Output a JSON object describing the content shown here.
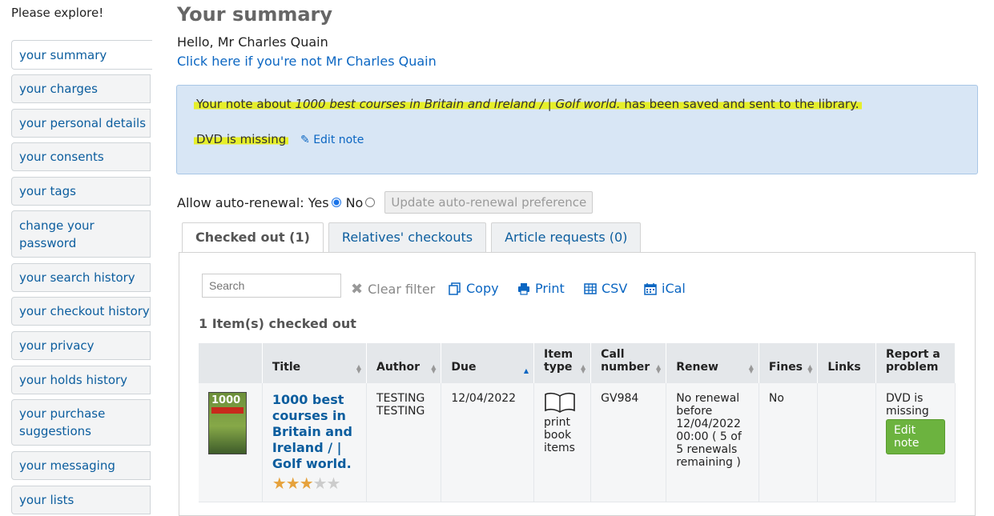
{
  "sidebar": {
    "heading": "Please explore!",
    "items": [
      {
        "label": "your summary"
      },
      {
        "label": "your charges"
      },
      {
        "label": "your personal details"
      },
      {
        "label": "your consents"
      },
      {
        "label": "your tags"
      },
      {
        "label": "change your password"
      },
      {
        "label": "your search history"
      },
      {
        "label": "your checkout history"
      },
      {
        "label": "your privacy"
      },
      {
        "label": "your holds history"
      },
      {
        "label": "your purchase suggestions"
      },
      {
        "label": "your messaging"
      },
      {
        "label": "your lists"
      }
    ]
  },
  "main": {
    "title": "Your summary",
    "hello": "Hello, Mr Charles Quain",
    "not_me_link": "Click here if you're not Mr Charles Quain",
    "alert": {
      "prefix": "Your note about ",
      "book_title": "1000 best courses in Britain and Ireland / | Golf world.",
      "suffix": " has been saved and sent to the library.",
      "note": "DVD is missing",
      "edit_note_link": "Edit note"
    },
    "autorenew": {
      "label": "Allow auto-renewal:",
      "yes": "Yes",
      "no": "No",
      "selected": "Yes",
      "update_button": "Update auto-renewal preference"
    },
    "tabs": [
      {
        "label": "Checked out (1)",
        "active": true
      },
      {
        "label": "Relatives' checkouts",
        "active": false
      },
      {
        "label": "Article requests (0)",
        "active": false
      }
    ],
    "toolbar": {
      "search_placeholder": "Search",
      "clear_filter": "Clear filter",
      "copy": "Copy",
      "print": "Print",
      "csv": "CSV",
      "ical": "iCal"
    },
    "checked_out_count": "1 Item(s) checked out",
    "table": {
      "headers": [
        "Title",
        "Author",
        "Due",
        "Item type",
        "Call number",
        "Renew",
        "Fines",
        "Links",
        "Report a problem"
      ],
      "rows": [
        {
          "cover_text": "1000",
          "title": "1000 best courses in Britain and Ireland / | Golf world.",
          "rating": 3,
          "rating_max": 5,
          "author": "TESTING TESTING",
          "due": "12/04/2022",
          "item_type_icon": "book-icon",
          "item_type": "print book items",
          "call_number": "GV984",
          "renew": "No renewal before 12/04/2022 00:00 ( 5 of 5 renewals remaining )",
          "fines": "No",
          "links": "",
          "problem_note": "DVD is missing",
          "edit_note_button": "Edit note"
        }
      ]
    }
  },
  "colors": {
    "link": "#0b66c2",
    "alert_bg": "#d8e6f5",
    "highlight": "#e6ef2a",
    "green_button": "#6cb33f"
  }
}
